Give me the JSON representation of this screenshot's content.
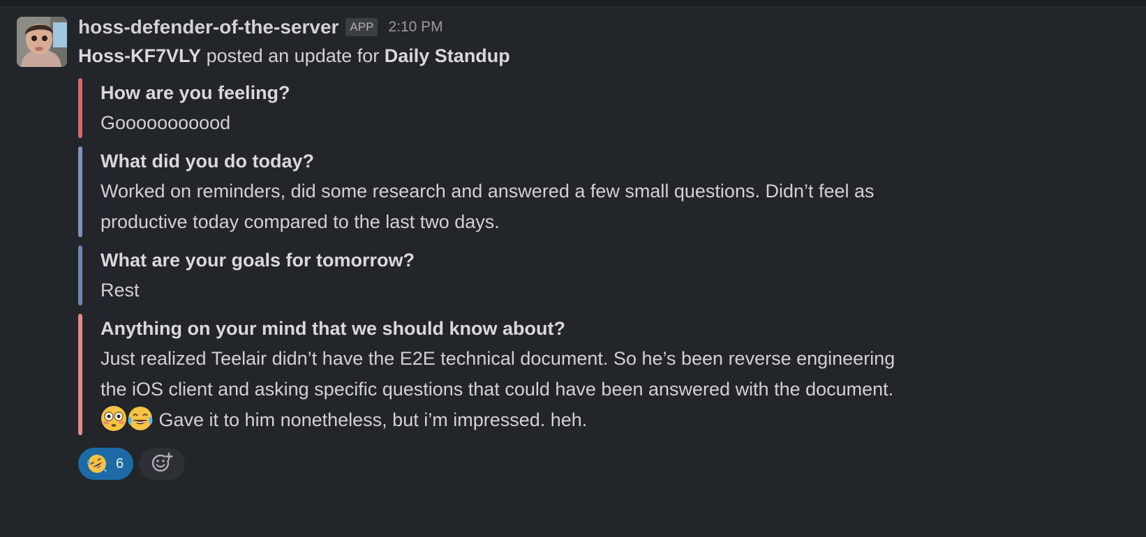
{
  "message": {
    "sender": "hoss-defender-of-the-server",
    "badge": "APP",
    "time": "2:10 PM",
    "intro": {
      "user": "Hoss-KF7VLY",
      "middle": " posted an update for ",
      "standup": "Daily Standup"
    },
    "attachments": [
      {
        "title": "How are you feeling?",
        "text": "Gooooooooood",
        "color": "#d86a6a"
      },
      {
        "title": "What did you do today?",
        "text": "Worked on reminders, did some research and answered a few small questions. Didn’t feel as productive today compared to the last two days.",
        "color": "#8093bd"
      },
      {
        "title": "What are your goals for tomorrow?",
        "text": "Rest",
        "color": "#6f86b5"
      },
      {
        "title": "Anything on your mind that we should know about?",
        "text_before": "Just realized Teelair didn’t have the E2E technical document. So he’s been reverse engineering the iOS client and asking specific questions that could have been answered with the document. ",
        "text_after": " Gave it to him nonetheless, but i’m impressed. heh.",
        "emojis": [
          "flushed-face",
          "face-with-tears-of-joy"
        ],
        "color": "#e48b8b"
      }
    ],
    "reactions": [
      {
        "emoji": "rolling-on-floor-laughing",
        "count": "6",
        "active": true
      }
    ],
    "add_reaction_icon": "add-reaction-icon"
  }
}
